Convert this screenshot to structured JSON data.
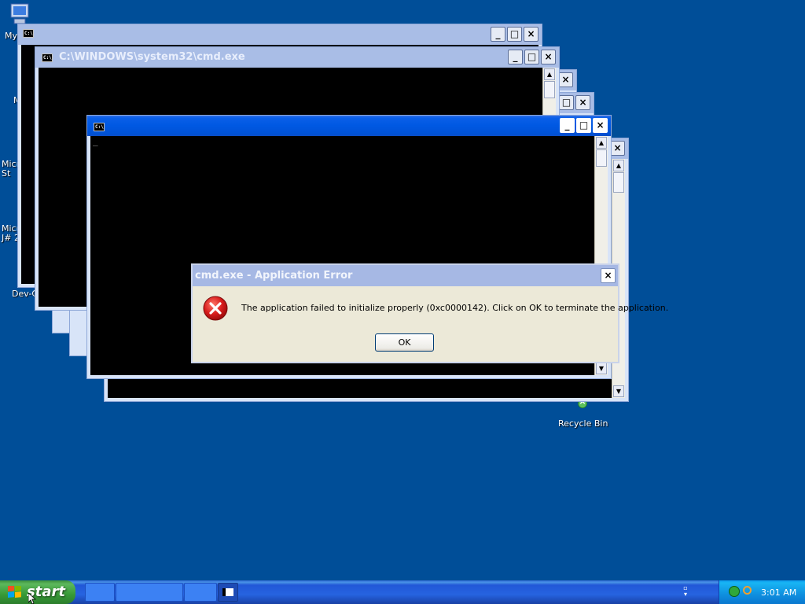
{
  "desktop": {
    "background": "#004e98",
    "icons": [
      {
        "name": "my-computer",
        "label": "My"
      },
      {
        "name": "m-item",
        "label": "M"
      },
      {
        "name": "micro-studio",
        "label": "Micro\nSt"
      },
      {
        "name": "micro-j",
        "label": "Micro\nJ# 2"
      },
      {
        "name": "dev-c",
        "label": "Dev-C"
      },
      {
        "name": "recycle-bin",
        "label": "Recycle Bin"
      }
    ]
  },
  "windows": {
    "cmd_title": "C:\\WINDOWS\\system32\\cmd.exe",
    "cmd_icon_text": "C:\\",
    "cursor": "_"
  },
  "dialog": {
    "title": "cmd.exe - Application Error",
    "message": "The application failed to initialize properly (0xc0000142). Click on OK to terminate the application.",
    "ok_label": "OK",
    "close_glyph": "×"
  },
  "taskbar": {
    "start_label": "start",
    "clock": "3:01 AM"
  },
  "colors": {
    "accent": "#0058e2",
    "taskbar": "#2663e0",
    "start_button": "#379a37",
    "error_red": "#cc1010"
  }
}
